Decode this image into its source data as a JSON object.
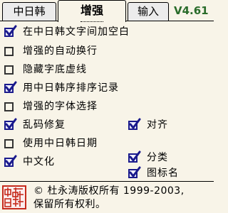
{
  "tabs": [
    {
      "label": "中日韩"
    },
    {
      "label": "增强"
    },
    {
      "label": "输入"
    }
  ],
  "version": "V4.61",
  "options": [
    {
      "label": "在中日韩文字间加空白",
      "checked": true
    },
    {
      "label": "增强的自动换行",
      "checked": false
    },
    {
      "label": "隐藏字底虚线",
      "checked": false
    },
    {
      "label": "用中日韩序排序记录",
      "checked": true
    },
    {
      "label": "增强的字体选择",
      "checked": false
    },
    {
      "label": "乱码修复",
      "checked": true
    },
    {
      "label": "对齐",
      "checked": true
    },
    {
      "label": "使用中日韩日期",
      "checked": false
    },
    {
      "label": "中文化",
      "checked": true
    },
    {
      "label": "分类",
      "checked": true
    },
    {
      "label": "图标名",
      "checked": true
    }
  ],
  "footer": {
    "line1": "© 杜永涛版权所有 1999-2003,",
    "line2": "保留所有权利。",
    "seal_text": "中日韩"
  },
  "colors": {
    "background": "#f8f4e8",
    "version": "#2a6c2a",
    "check": "#1a1a8c",
    "seal": "#c62b1c"
  }
}
